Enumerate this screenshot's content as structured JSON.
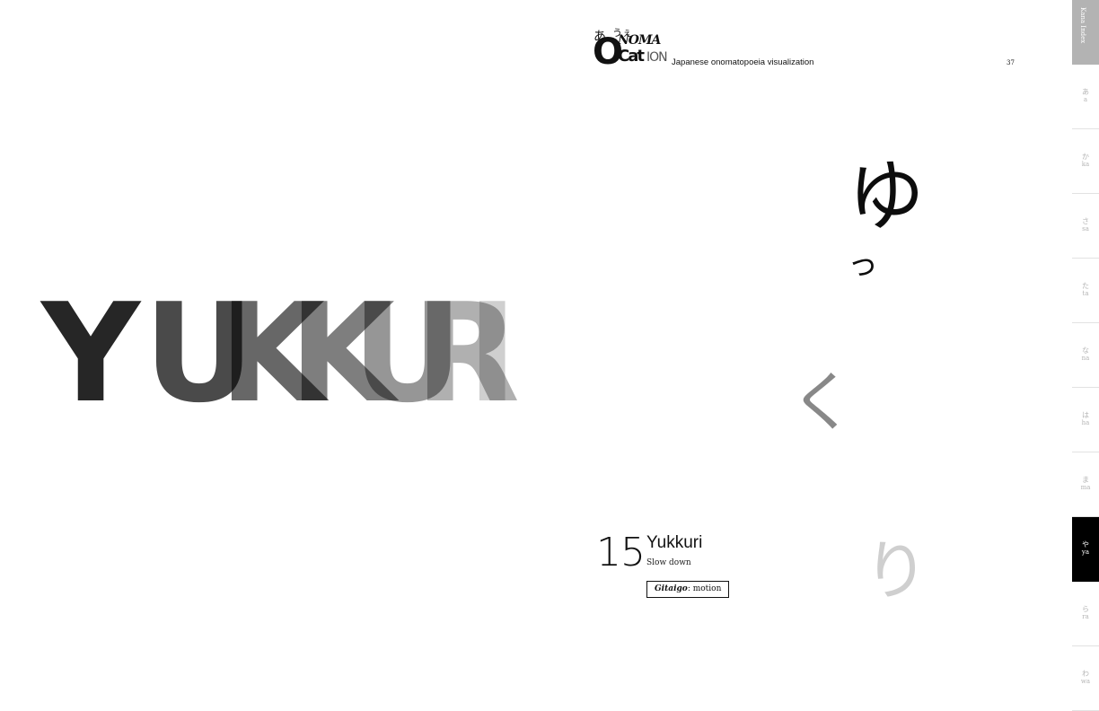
{
  "hero_word": {
    "letters": [
      "Y",
      "U",
      "K",
      "K",
      "U",
      "R",
      "I"
    ],
    "colors": [
      "#262626",
      "#4a4a4a",
      "#676767",
      "#7e7e7e",
      "#969696",
      "#b0b0b0",
      "#cfcfcf"
    ]
  },
  "header": {
    "logo": {
      "kana_1": "あ",
      "kana_2": "うぇ",
      "big_o": "O",
      "nom": "NOMA",
      "cat": "Cat",
      "ion": "ION"
    },
    "tagline": "Japanese onomatopoeia visualization",
    "page_number": "37"
  },
  "kana_column": {
    "yu": "ゆ",
    "tsu": "っ",
    "ku": "く",
    "ri": "り"
  },
  "entry": {
    "number": "15",
    "title": "Yukkuri",
    "subtitle": "Slow down",
    "tag_key": "Gitaigo",
    "tag_value": "motion"
  },
  "sidebar": {
    "header": "Kana Index",
    "active_index": 7,
    "items": [
      {
        "kana": "あ",
        "romaji": "a"
      },
      {
        "kana": "か",
        "romaji": "ka"
      },
      {
        "kana": "さ",
        "romaji": "sa"
      },
      {
        "kana": "た",
        "romaji": "ta"
      },
      {
        "kana": "な",
        "romaji": "na"
      },
      {
        "kana": "は",
        "romaji": "ha"
      },
      {
        "kana": "ま",
        "romaji": "ma"
      },
      {
        "kana": "や",
        "romaji": "ya"
      },
      {
        "kana": "ら",
        "romaji": "ra"
      },
      {
        "kana": "わ",
        "romaji": "wa"
      }
    ]
  }
}
